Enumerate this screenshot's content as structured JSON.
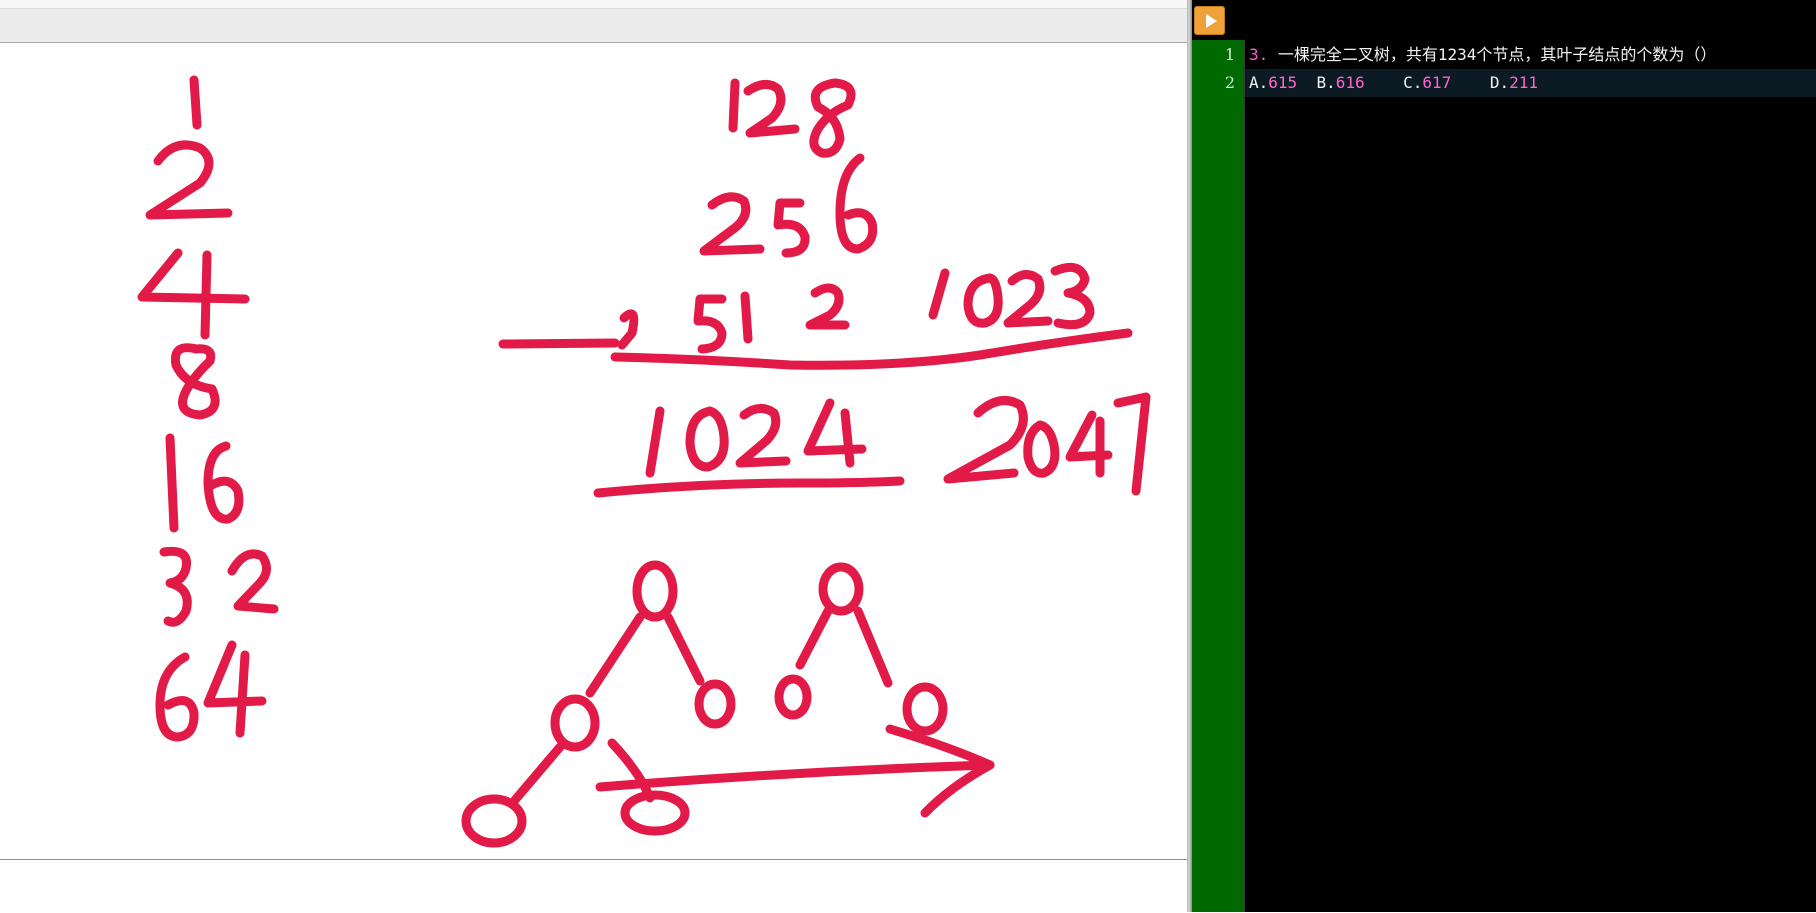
{
  "whiteboard": {
    "ink_color": "#e11a47",
    "handwriting": {
      "left_column": [
        "1",
        "2",
        "4",
        "8",
        "16",
        "32",
        "64"
      ],
      "right_column": [
        "128",
        "256",
        "512",
        "1023",
        "1024",
        "2047"
      ]
    }
  },
  "editor": {
    "run_icon": "play-icon",
    "line_numbers": [
      "1",
      "2"
    ],
    "line1": {
      "prefix": "3.",
      "text": " 一棵完全二叉树，共有1234个节点，其叶子结点的个数为（）"
    },
    "line2": {
      "a_label": "A.",
      "a_value": "615",
      "b_label": "B.",
      "b_value": "616",
      "c_label": "C.",
      "c_value": "617",
      "d_label": "D.",
      "d_value": "211"
    },
    "colors": {
      "gutter": "#006a00",
      "background": "#000000",
      "number_highlight": "#ff5fd2",
      "run_button": "#f0a23a"
    }
  }
}
